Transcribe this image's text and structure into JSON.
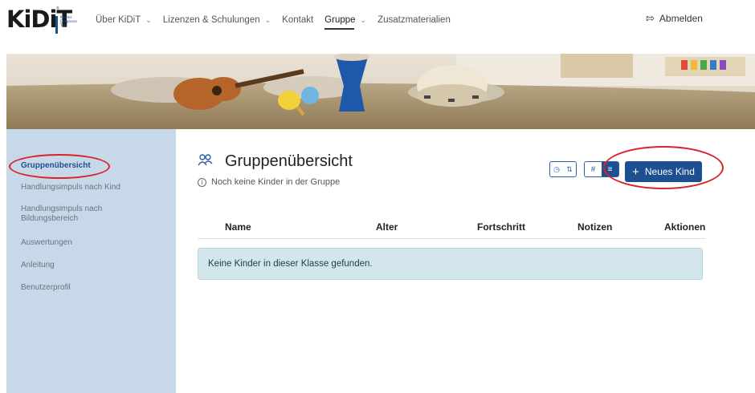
{
  "header": {
    "logo_text": "KiDiT",
    "logo_tm": "®",
    "logo_subtitle": [
      "Kinder",
      "Diagnose",
      "Tool"
    ],
    "nav": [
      {
        "label": "Über KiDiT",
        "has_dropdown": true,
        "active": false
      },
      {
        "label": "Lizenzen & Schulungen",
        "has_dropdown": true,
        "active": false
      },
      {
        "label": "Kontakt",
        "has_dropdown": false,
        "active": false
      },
      {
        "label": "Gruppe",
        "has_dropdown": true,
        "active": true
      },
      {
        "label": "Zusatzmaterialien",
        "has_dropdown": false,
        "active": false
      }
    ],
    "logout_label": "Abmelden"
  },
  "sidebar": {
    "items": [
      {
        "label": "Gruppenübersicht",
        "active": true
      },
      {
        "label": "Handlungsimpuls nach Kind",
        "active": false
      },
      {
        "label": "Handlungsimpuls nach Bildungsbereich",
        "active": false
      },
      {
        "label": "Auswertungen",
        "active": false
      },
      {
        "label": "Anleitung",
        "active": false
      },
      {
        "label": "Benutzerprofil",
        "active": false
      }
    ]
  },
  "main": {
    "title": "Gruppenübersicht",
    "subtitle": "Noch keine Kinder in der Gruppe",
    "new_button_label": "Neues Kind",
    "table": {
      "columns": [
        "Name",
        "Alter",
        "Fortschritt",
        "Notizen",
        "Aktionen"
      ],
      "empty_message": "Keine Kinder in dieser Klasse gefunden."
    }
  },
  "colors": {
    "brand_blue": "#1d4f91",
    "sidebar_bg": "#c7d8e9",
    "annotation_red": "#d8232a",
    "empty_box_bg": "#d3e6ec"
  }
}
